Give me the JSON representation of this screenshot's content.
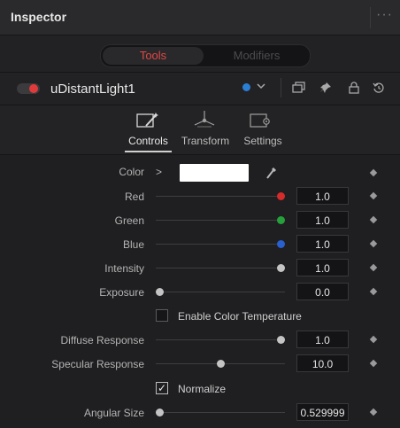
{
  "header": {
    "title": "Inspector",
    "more_icon": "more-dots-icon"
  },
  "tabs": {
    "active": "Tools",
    "inactive": "Modifiers",
    "active_color": "#e24646"
  },
  "node": {
    "name": "uDistantLight1",
    "toggle_color": "#e03a3a",
    "version_dot_color": "#2a7fd4",
    "icons": [
      "color-dot-icon",
      "chevron-down-icon",
      "copy-icon",
      "pin-icon",
      "lock-icon",
      "reset-icon"
    ]
  },
  "subtabs": [
    {
      "label": "Controls",
      "icon": "controls-wand-icon"
    },
    {
      "label": "Transform",
      "icon": "transform-axes-icon"
    },
    {
      "label": "Settings",
      "icon": "settings-gear-icon"
    }
  ],
  "controls": {
    "color": {
      "label": "Color",
      "chevron": ">",
      "swatch": "#ffffff",
      "picker_icon": "eyedropper-icon"
    },
    "red": {
      "label": "Red",
      "value": "1.0",
      "knob_color": "#d42b2b",
      "level": 1.0
    },
    "green": {
      "label": "Green",
      "value": "1.0",
      "knob_color": "#25a03a",
      "level": 1.0
    },
    "blue": {
      "label": "Blue",
      "value": "1.0",
      "knob_color": "#2a5fd0",
      "level": 1.0
    },
    "intensity": {
      "label": "Intensity",
      "value": "1.0",
      "level": 1.0
    },
    "exposure": {
      "label": "Exposure",
      "value": "0.0",
      "level": 0.0
    },
    "enable_color_temp": {
      "label": "Enable Color Temperature",
      "checked": false
    },
    "diffuse": {
      "label": "Diffuse Response",
      "value": "1.0",
      "level": 1.0
    },
    "specular": {
      "label": "Specular Response",
      "value": "10.0",
      "level": 0.5
    },
    "normalize": {
      "label": "Normalize",
      "checked": true,
      "check": "✓"
    },
    "angular": {
      "label": "Angular Size",
      "value": "0.529999",
      "level": 0.0
    }
  }
}
